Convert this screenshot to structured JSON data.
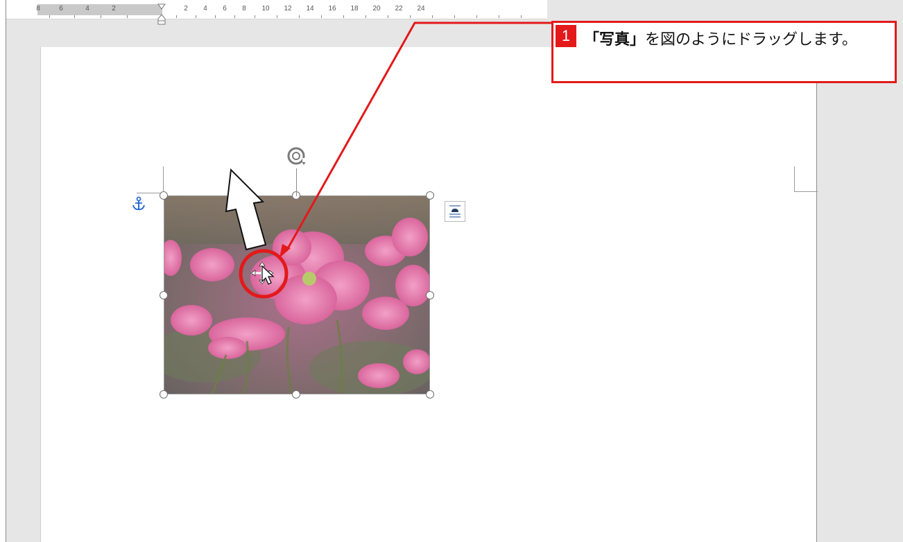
{
  "ruler": {
    "labels": [
      "8",
      "6",
      "4",
      "2",
      "2",
      "4",
      "6",
      "8",
      "10",
      "12",
      "14",
      "16",
      "18",
      "20",
      "22",
      "24"
    ]
  },
  "callout": {
    "step_number": "1",
    "text_bold": "「写真」",
    "text_rest": "を図のようにドラッグします。",
    "border_color": "#e3191a"
  },
  "image": {
    "content": "pink flowers photo"
  },
  "colors": {
    "annotation_red": "#e3191a",
    "layout_icon_blue": "#2e6dd1"
  },
  "icons": {
    "anchor": "anchor-icon",
    "rotate": "rotate-icon",
    "layout_options": "layout-options-icon",
    "move_cursor": "move-cursor-icon",
    "drag_arrow": "up-arrow-icon"
  }
}
